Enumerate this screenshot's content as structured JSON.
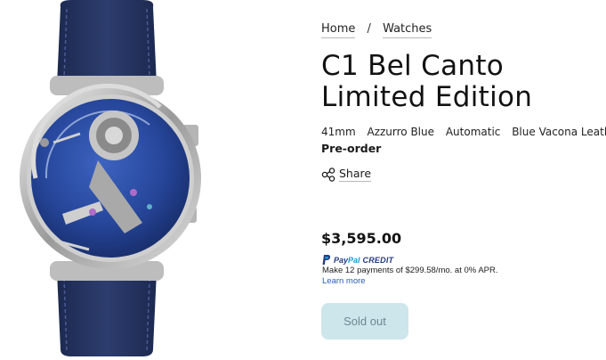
{
  "breadcrumb": {
    "home": "Home",
    "separator": "/",
    "current": "Watches"
  },
  "product": {
    "title": "C1 Bel Canto Limited Edition",
    "specs": [
      "41mm",
      "Azzurro Blue",
      "Automatic",
      "Blue Vacona Leather"
    ],
    "availability": "Pre-order",
    "share_label": "Share",
    "price": "$3,595.00"
  },
  "paypal": {
    "word1": "Pay",
    "word2": "Pal",
    "credit": "CREDIT",
    "payments_text": "Make 12 payments of $299.58/mo. at 0% APR.",
    "learn_more": "Learn more"
  },
  "actions": {
    "sold_out_label": "Sold out"
  },
  "icons": {
    "share": "share-icon",
    "paypal": "paypal-icon"
  },
  "colors": {
    "sold_out_bg": "#cde6ec",
    "sold_out_text": "#6b8791",
    "paypal_dark": "#253b80",
    "paypal_light": "#179bd7",
    "link": "#2a5db0",
    "strap": "#243463",
    "dial": "#2b4aa0"
  }
}
